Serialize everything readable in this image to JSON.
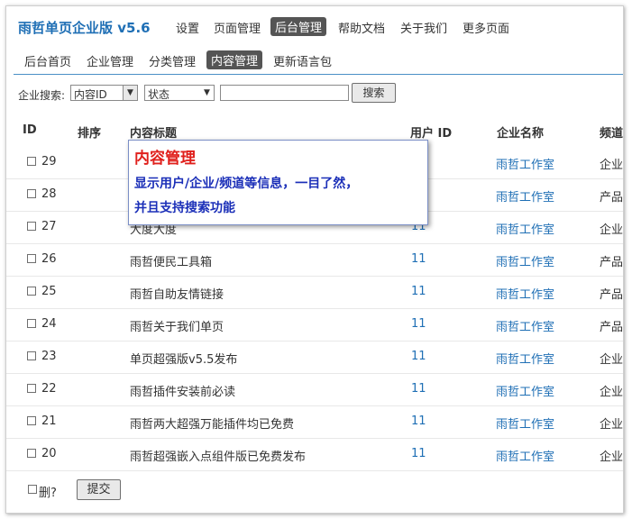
{
  "header": {
    "brand": "雨哲单页企业版 v5.6",
    "nav": [
      {
        "label": "设置",
        "active": false
      },
      {
        "label": "页面管理",
        "active": false
      },
      {
        "label": "后台管理",
        "active": true
      },
      {
        "label": "帮助文档",
        "active": false
      },
      {
        "label": "关于我们",
        "active": false
      },
      {
        "label": "更多页面",
        "active": false
      }
    ]
  },
  "subnav": [
    {
      "label": "后台首页",
      "active": false
    },
    {
      "label": "企业管理",
      "active": false
    },
    {
      "label": "分类管理",
      "active": false
    },
    {
      "label": "内容管理",
      "active": true
    },
    {
      "label": "更新语言包",
      "active": false
    }
  ],
  "search": {
    "label": "企业搜索:",
    "field_select": "内容ID",
    "status_select": "状态",
    "input_value": "",
    "button_label": "搜索"
  },
  "table": {
    "columns": [
      "ID",
      "排序",
      "内容标题",
      "用户 ID",
      "企业名称",
      "频道"
    ],
    "rows": [
      {
        "id": "29",
        "title": "",
        "user_id": "",
        "company": "雨哲工作室",
        "channel": "企业"
      },
      {
        "id": "28",
        "title": "",
        "user_id": "",
        "company": "雨哲工作室",
        "channel": "产品"
      },
      {
        "id": "27",
        "title": "大度大度",
        "user_id": "11",
        "company": "雨哲工作室",
        "channel": "企业"
      },
      {
        "id": "26",
        "title": "雨哲便民工具箱",
        "user_id": "11",
        "company": "雨哲工作室",
        "channel": "产品"
      },
      {
        "id": "25",
        "title": "雨哲自助友情链接",
        "user_id": "11",
        "company": "雨哲工作室",
        "channel": "产品"
      },
      {
        "id": "24",
        "title": "雨哲关于我们单页",
        "user_id": "11",
        "company": "雨哲工作室",
        "channel": "产品"
      },
      {
        "id": "23",
        "title": "单页超强版v5.5发布",
        "user_id": "11",
        "company": "雨哲工作室",
        "channel": "企业"
      },
      {
        "id": "22",
        "title": "雨哲插件安装前必读",
        "user_id": "11",
        "company": "雨哲工作室",
        "channel": "企业"
      },
      {
        "id": "21",
        "title": "雨哲两大超强万能插件均已免费",
        "user_id": "11",
        "company": "雨哲工作室",
        "channel": "企业"
      },
      {
        "id": "20",
        "title": "雨哲超强嵌入点组件版已免费发布",
        "user_id": "11",
        "company": "雨哲工作室",
        "channel": "企业"
      }
    ]
  },
  "footer": {
    "delete_label": "删?",
    "submit_label": "提交"
  },
  "tooltip": {
    "title": "内容管理",
    "line1": "显示用户/企业/频道等信息，一目了然，",
    "line2": "并且支持搜索功能"
  }
}
